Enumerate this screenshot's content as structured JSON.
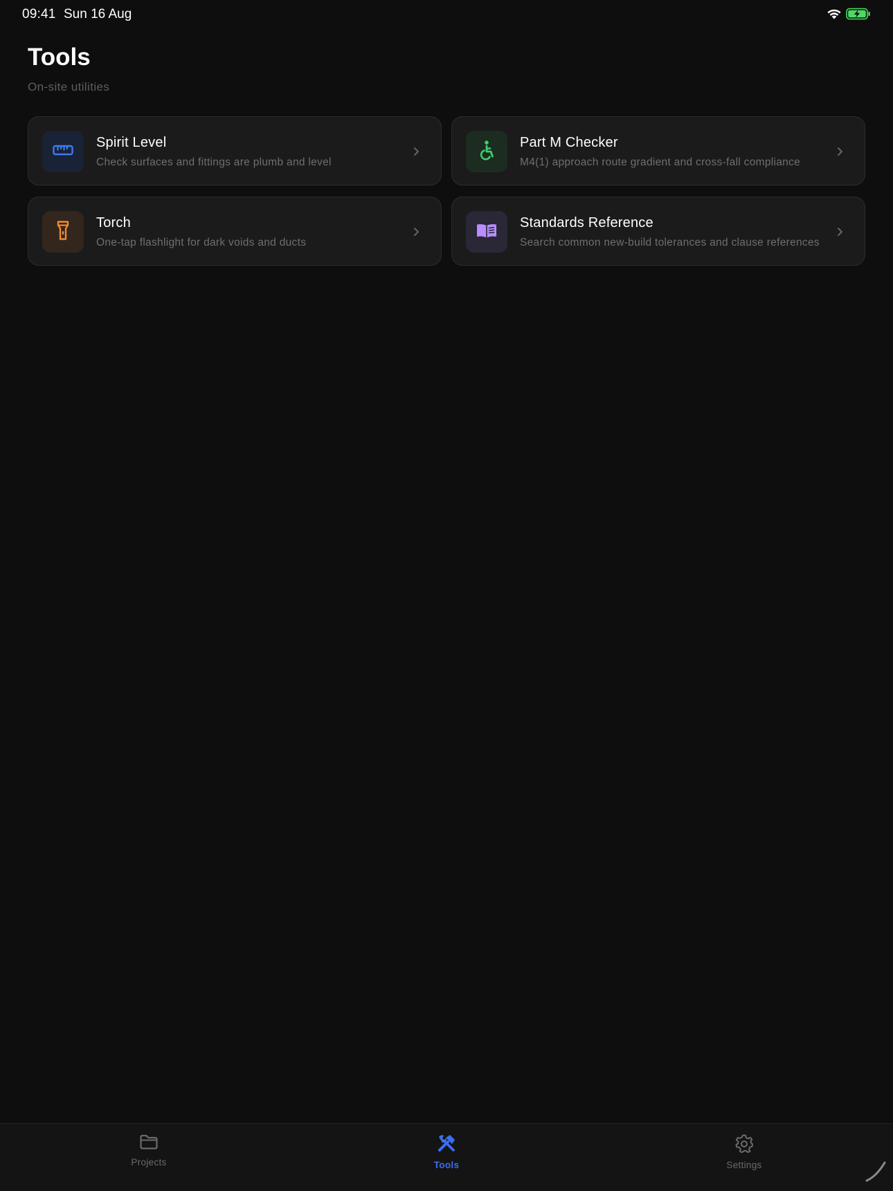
{
  "status_bar": {
    "time": "09:41",
    "date": "Sun 16 Aug"
  },
  "header": {
    "title": "Tools",
    "subtitle": "On-site utilities"
  },
  "tools": [
    {
      "title": "Spirit Level",
      "description": "Check surfaces and fittings are plumb and level",
      "icon": "ruler-icon",
      "accent": "#3d7bf0",
      "tile": "#1a2236"
    },
    {
      "title": "Part M Checker",
      "description": "M4(1) approach route gradient and cross-fall compliance",
      "icon": "wheelchair-icon",
      "accent": "#3ecf6e",
      "tile": "#1c2c21"
    },
    {
      "title": "Torch",
      "description": "One-tap flashlight for dark voids and ducts",
      "icon": "flashlight-icon",
      "accent": "#f08a33",
      "tile": "#33261c"
    },
    {
      "title": "Standards Reference",
      "description": "Search common new-build tolerances and clause references",
      "icon": "book-icon",
      "accent": "#b98cff",
      "tile": "#2a2736"
    }
  ],
  "tab_bar": {
    "tabs": [
      {
        "label": "Projects",
        "icon": "folder-icon",
        "active": false
      },
      {
        "label": "Tools",
        "icon": "tools-icon",
        "active": true
      },
      {
        "label": "Settings",
        "icon": "gear-icon",
        "active": false
      }
    ],
    "active_color": "#3a6ff0",
    "inactive_color": "#6b6b6b"
  }
}
